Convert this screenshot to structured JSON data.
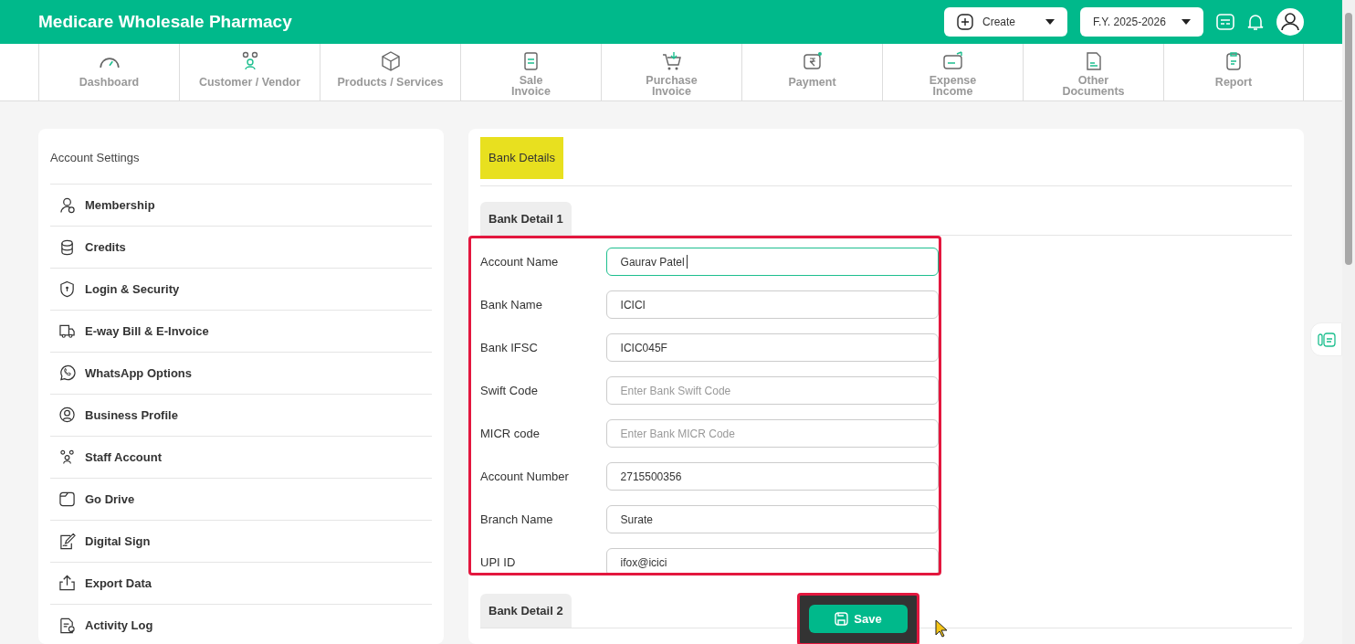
{
  "header": {
    "title": "Medicare Wholesale Pharmacy",
    "create_button": {
      "label": "Create"
    },
    "year_select": {
      "value": "F.Y. 2025-2026"
    }
  },
  "nav": [
    {
      "lines": [
        "Dashboard"
      ]
    },
    {
      "lines": [
        "Customer / Vendor"
      ]
    },
    {
      "lines": [
        "Products / Services"
      ]
    },
    {
      "lines": [
        "Sale",
        "Invoice"
      ]
    },
    {
      "lines": [
        "Purchase",
        "Invoice"
      ]
    },
    {
      "lines": [
        "Payment"
      ]
    },
    {
      "lines": [
        "Expense",
        "Income"
      ]
    },
    {
      "lines": [
        "Other",
        "Documents"
      ]
    },
    {
      "lines": [
        "Report"
      ]
    }
  ],
  "sidebar": {
    "title": "Account Settings",
    "items": [
      {
        "label": "Membership"
      },
      {
        "label": "Credits"
      },
      {
        "label": "Login & Security"
      },
      {
        "label": "E-way Bill & E-Invoice"
      },
      {
        "label": "WhatsApp Options"
      },
      {
        "label": "Business Profile"
      },
      {
        "label": "Staff Account"
      },
      {
        "label": "Go Drive"
      },
      {
        "label": "Digital Sign"
      },
      {
        "label": "Export Data"
      },
      {
        "label": "Activity Log"
      }
    ]
  },
  "panel": {
    "title": "Bank Details",
    "sections": [
      {
        "title": "Bank Detail 1",
        "fields": [
          {
            "label": "Account Name",
            "value": "Gaurav Patel",
            "focused": true
          },
          {
            "label": "Bank Name",
            "value": "ICICI",
            "focused": false
          },
          {
            "label": "Bank IFSC",
            "value": "ICIC045F",
            "focused": false
          },
          {
            "label": "Swift Code",
            "placeholder": "Enter Bank Swift Code",
            "focused": false
          },
          {
            "label": "MICR code",
            "placeholder": "Enter Bank MICR Code",
            "focused": false
          },
          {
            "label": "Account Number",
            "value": "2715500356",
            "focused": false
          },
          {
            "label": "Branch Name",
            "value": "Surate",
            "focused": false
          },
          {
            "label": "UPI ID",
            "value": "ifox@icici",
            "focused": false
          }
        ]
      },
      {
        "title": "Bank Detail 2"
      }
    ]
  },
  "save_button": {
    "label": "Save"
  }
}
